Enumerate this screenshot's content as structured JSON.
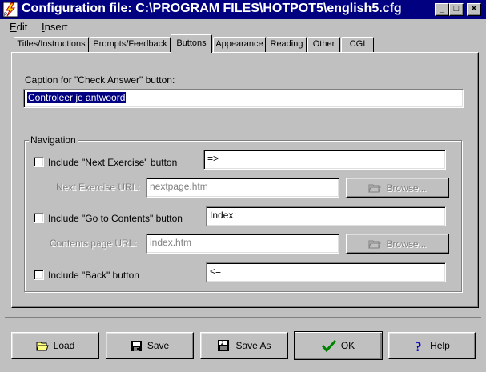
{
  "window": {
    "title": "Configuration file: C:\\PROGRAM FILES\\HOTPOT5\\english5.cfg",
    "minimize_glyph": "_",
    "maximize_glyph": "□",
    "close_glyph": "✕"
  },
  "menu": [
    {
      "label": "Edit",
      "accel": "E",
      "rest": "dit"
    },
    {
      "label": "Insert",
      "accel": "I",
      "rest": "nsert"
    }
  ],
  "tabs": [
    {
      "label": "Titles/Instructions",
      "active": false
    },
    {
      "label": "Prompts/Feedback",
      "active": false
    },
    {
      "label": "Buttons",
      "active": true
    },
    {
      "label": "Appearance",
      "active": false
    },
    {
      "label": "Reading",
      "active": false
    },
    {
      "label": "Other",
      "active": false
    },
    {
      "label": "CGI",
      "active": false
    }
  ],
  "check_answer": {
    "label": "Caption for \"Check Answer\" button:",
    "value": "Controleer je antwoord"
  },
  "navigation": {
    "legend": "Navigation",
    "next": {
      "checkbox_label": "Include \"Next Exercise\" button",
      "checked": false,
      "caption": "=>",
      "url_label": "Next Exercise URL:",
      "url_value": "nextpage.htm",
      "browse_label": "Browse..."
    },
    "contents": {
      "checkbox_label": "Include \"Go to Contents\" button",
      "checked": false,
      "caption": "Index",
      "url_label": "Contents page URL:",
      "url_value": "index.htm",
      "browse_label": "Browse..."
    },
    "back": {
      "checkbox_label": "Include \"Back\" button",
      "checked": false,
      "caption": "<="
    }
  },
  "buttons": {
    "load": {
      "accel": "L",
      "rest": "oad",
      "icon": "folder-open-icon"
    },
    "save": {
      "accel": "S",
      "rest": "ave",
      "icon": "floppy-disk-icon"
    },
    "save_as": {
      "pre": "Save ",
      "accel": "A",
      "rest": "s",
      "icon": "floppy-disk-2-icon"
    },
    "ok": {
      "accel": "O",
      "rest": "K",
      "icon": "checkmark-icon"
    },
    "help": {
      "accel": "H",
      "rest": "elp",
      "icon": "question-mark-icon"
    }
  },
  "colors": {
    "titlebar": "#000080",
    "face": "#c0c0c0",
    "selection": "#000080",
    "disabled_text": "#808080"
  }
}
